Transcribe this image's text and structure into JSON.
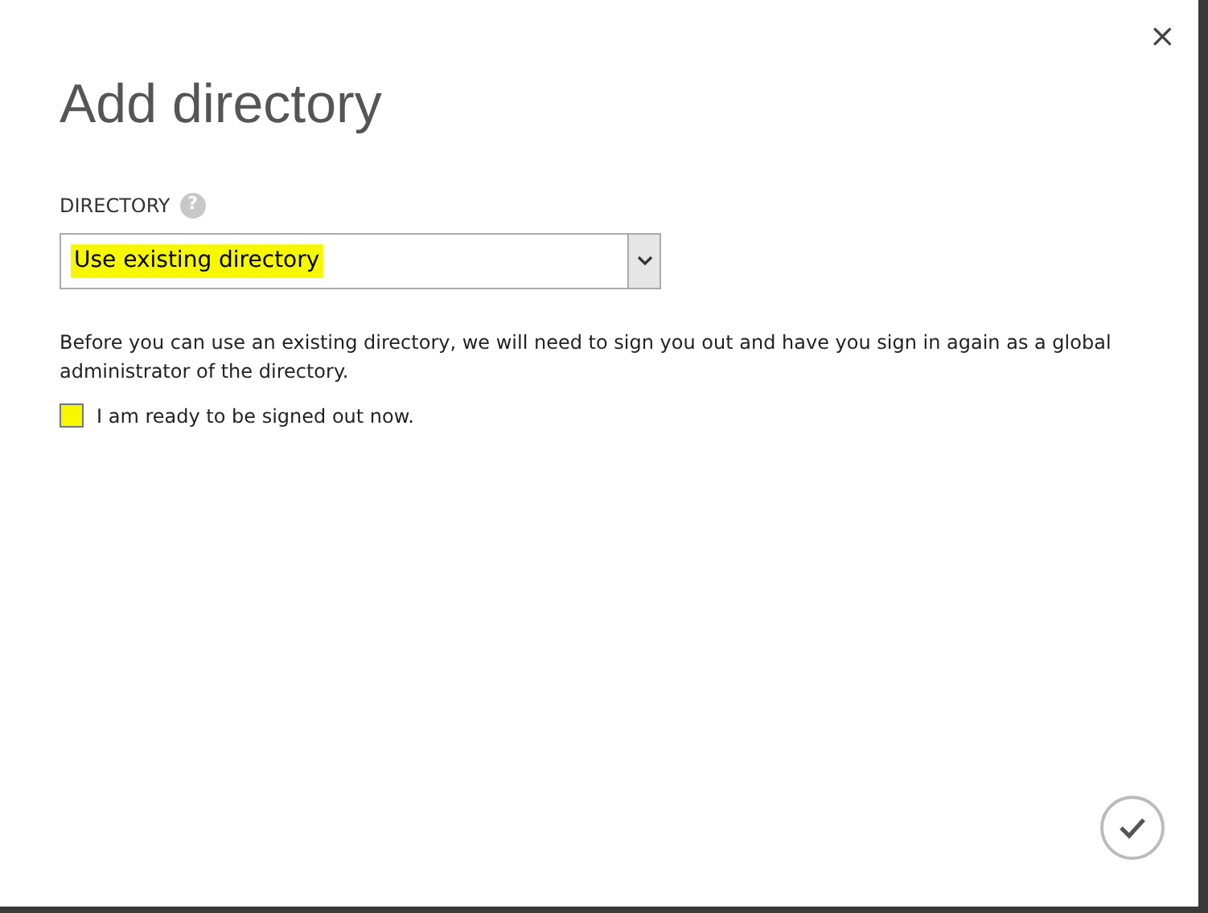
{
  "dialog": {
    "title": "Add directory",
    "close": "×"
  },
  "directory_field": {
    "label": "DIRECTORY",
    "help": "?",
    "value": "Use existing directory",
    "highlighted": true
  },
  "message": "Before you can use an existing directory, we will need to sign you out and have you sign in again as a global administrator of the directory.",
  "confirm_signout": {
    "label": "I am ready to be signed out now.",
    "checked": false,
    "highlighted": true
  }
}
